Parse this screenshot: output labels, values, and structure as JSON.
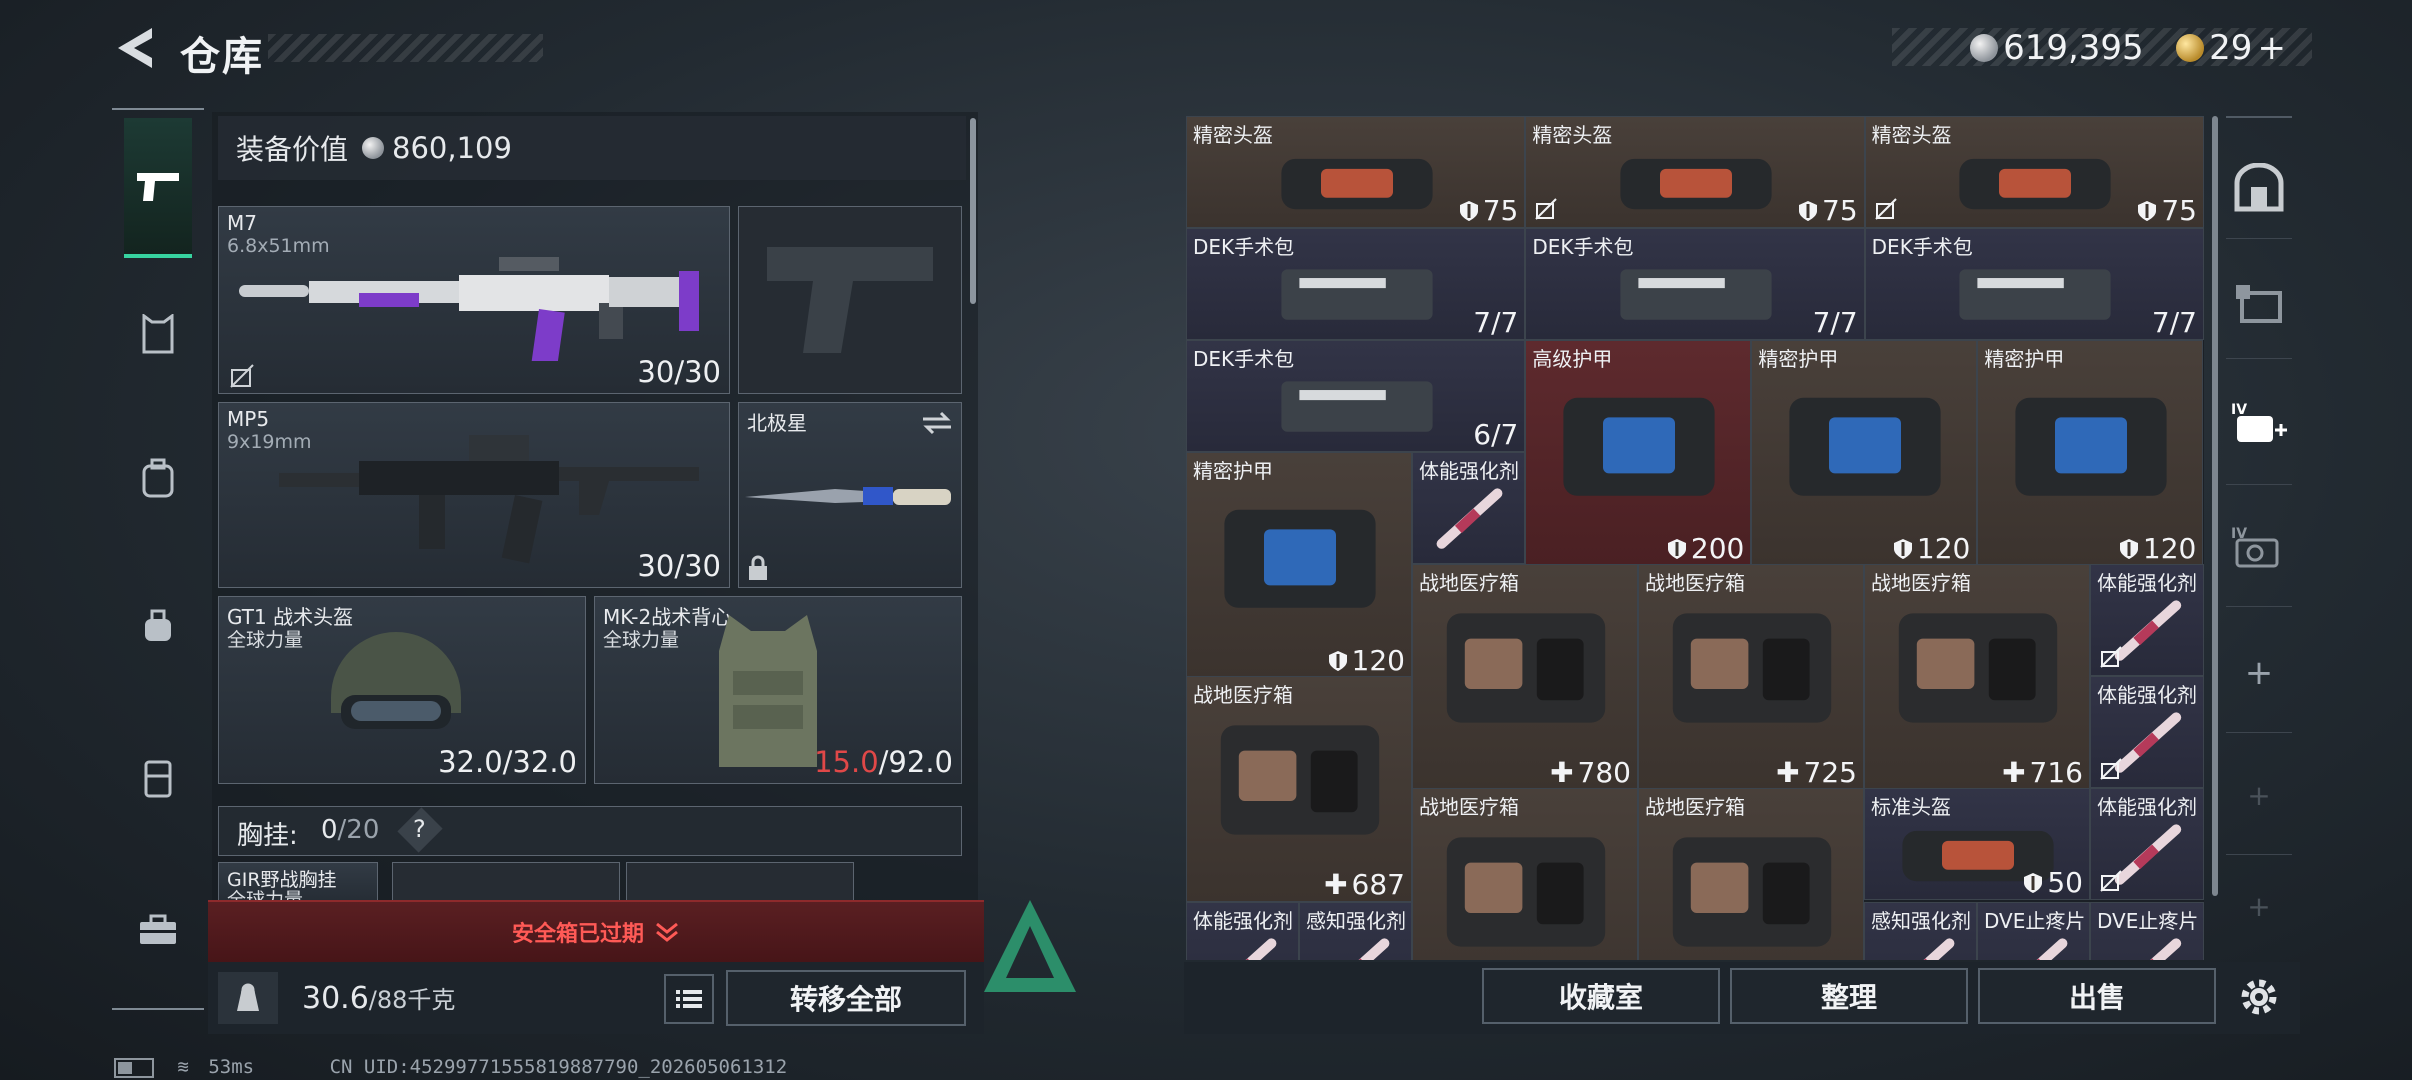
{
  "header": {
    "title": "仓库",
    "silver_amount": "619,395",
    "gold_amount": "29",
    "gold_add": "+"
  },
  "colors": {
    "accent": "#37d3a0",
    "warning": "#ff5a56",
    "damaged": "#e04848"
  },
  "nav": {
    "items": [
      "pistol-icon",
      "armor-icon",
      "backpack-icon",
      "pouch-icon",
      "chest-rig-icon",
      "toolbox-icon"
    ]
  },
  "loadout": {
    "equipment_value_label": "装备价值",
    "equipment_value": "860,109",
    "primary": {
      "name": "M7",
      "caliber": "6.8x51mm",
      "ammo": "30/30"
    },
    "secondary": {
      "name": "MP5",
      "caliber": "9x19mm",
      "ammo": "30/30"
    },
    "melee": {
      "name": "北极星"
    },
    "helmet": {
      "name": "GT1 战术头盔",
      "faction": "全球力量",
      "durability": "32.0/32.0"
    },
    "vest": {
      "name": "MK-2战术背心",
      "faction": "全球力量",
      "durability_current": "15.0",
      "durability_max": "/92.0"
    },
    "chest_rig": {
      "label": "胸挂:",
      "count": "0",
      "capacity": "/20",
      "help": "?"
    },
    "rig_item": {
      "name": "GIR野战胸挂",
      "faction": "全球力量"
    }
  },
  "safebox_warning": "安全箱已过期",
  "weight": {
    "current": "30.6",
    "max": "/88千克",
    "unit_icon": "KG"
  },
  "buttons": {
    "transfer_all": "转移全部",
    "collection": "收藏室",
    "organize": "整理",
    "sell": "出售"
  },
  "grid_items": [
    {
      "name": "精密头盔",
      "value": "75",
      "icon": "shield",
      "color": "brown",
      "lock": false
    },
    {
      "name": "精密头盔",
      "value": "75",
      "icon": "shield",
      "color": "brown",
      "lock": true
    },
    {
      "name": "精密头盔",
      "value": "75",
      "icon": "shield",
      "color": "brown",
      "lock": true
    },
    {
      "name": "DEK手术包",
      "value": "7/7",
      "icon": "",
      "color": "navy",
      "lock": false
    },
    {
      "name": "DEK手术包",
      "value": "7/7",
      "icon": "",
      "color": "navy",
      "lock": false
    },
    {
      "name": "DEK手术包",
      "value": "7/7",
      "icon": "",
      "color": "navy",
      "lock": false
    },
    {
      "name": "DEK手术包",
      "value": "6/7",
      "icon": "",
      "color": "navy",
      "lock": false
    },
    {
      "name": "高级护甲",
      "value": "200",
      "icon": "shield",
      "color": "red",
      "lock": false
    },
    {
      "name": "精密护甲",
      "value": "120",
      "icon": "shield",
      "color": "brown",
      "lock": false
    },
    {
      "name": "精密护甲",
      "value": "120",
      "icon": "shield",
      "color": "brown",
      "lock": false
    },
    {
      "name": "精密护甲",
      "value": "120",
      "icon": "shield",
      "color": "brown",
      "lock": false
    },
    {
      "name": "体能强化剂",
      "value": "",
      "icon": "",
      "color": "navy",
      "lock": false
    },
    {
      "name": "战地医疗箱",
      "value": "780",
      "icon": "plus",
      "color": "brown",
      "lock": false
    },
    {
      "name": "战地医疗箱",
      "value": "725",
      "icon": "plus",
      "color": "brown",
      "lock": false
    },
    {
      "name": "战地医疗箱",
      "value": "716",
      "icon": "plus",
      "color": "brown",
      "lock": false
    },
    {
      "name": "体能强化剂",
      "value": "",
      "icon": "",
      "color": "navy",
      "lock": true
    },
    {
      "name": "战地医疗箱",
      "value": "687",
      "icon": "plus",
      "color": "brown",
      "lock": false
    },
    {
      "name": "体能强化剂",
      "value": "",
      "icon": "",
      "color": "navy",
      "lock": true
    },
    {
      "name": "战地医疗箱",
      "value": "",
      "icon": "",
      "color": "brown",
      "lock": false
    },
    {
      "name": "战地医疗箱",
      "value": "",
      "icon": "",
      "color": "brown",
      "lock": false
    },
    {
      "name": "标准头盔",
      "value": "50",
      "icon": "shield",
      "color": "navy",
      "lock": false
    },
    {
      "name": "体能强化剂",
      "value": "",
      "icon": "",
      "color": "navy",
      "lock": true
    },
    {
      "name": "体能强化剂",
      "value": "",
      "icon": "",
      "color": "navy",
      "lock": false
    },
    {
      "name": "感知强化剂",
      "value": "",
      "icon": "",
      "color": "navy",
      "lock": false
    },
    {
      "name": "感知强化剂",
      "value": "",
      "icon": "",
      "color": "navy",
      "lock": false
    },
    {
      "name": "DVE止疼片",
      "value": "",
      "icon": "",
      "color": "navy",
      "lock": false
    },
    {
      "name": "DVE止疼片",
      "value": "",
      "icon": "",
      "color": "navy",
      "lock": false
    }
  ],
  "rail": {
    "items": [
      "vault-icon",
      "stash-icon",
      "pack-add-icon",
      "scope-icon",
      "plus-icon",
      "plus-icon",
      "plus-icon"
    ]
  },
  "status": {
    "ping": "53ms",
    "uid": "CN UID:4529977155581988779​0_202605061312"
  }
}
